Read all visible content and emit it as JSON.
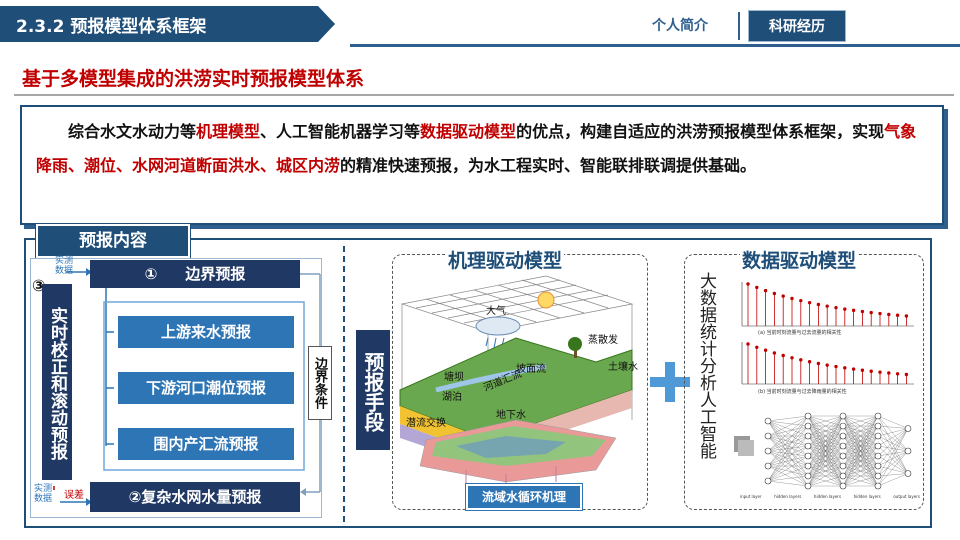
{
  "header": {
    "title": "2.3.2 预报模型体系框架",
    "nav": [
      "个人简介",
      "科研经历"
    ]
  },
  "subtitle": "基于多模型集成的洪涝实时预报模型体系",
  "intro": {
    "p1": "综合水文水动力等",
    "h1": "机理模型",
    "p2": "、人工智能机器学习等",
    "h2": "数据驱动模型",
    "p3": "的优点，构建自适应的洪涝预报模型体系框架，实现",
    "h3": "气象降雨、潮位、水网河道断面洪水、城区内涝",
    "p4": "的精准快速预报，为水工程实时、智能联排联调提供基础。"
  },
  "panel": {
    "tab": "预报内容",
    "top_small": "实测\n数据",
    "marker_1": "①",
    "boundary_forecast": "边界预报",
    "marker_3": "③",
    "realtime": "实时校正和滚动预报",
    "items": [
      "上游来水预报",
      "下游河口潮位预报",
      "围内产汇流预报"
    ],
    "boundary_condition": "边界条件",
    "bottom_small": "实测\n数据",
    "error": "误差",
    "complex": "②复杂水网水量预报"
  },
  "stage_label": "预报手段",
  "mechanism": {
    "title": "机理驱动模型",
    "labels": {
      "atmosphere": "大气",
      "evap": "蒸散发",
      "soil": "土壤水",
      "dam": "塘坝",
      "lake": "湖泊",
      "river": "河道汇流",
      "slope": "坡面流",
      "groundwater": "地下水",
      "exchange": "潜流交换"
    },
    "caption": "流域水循环机理"
  },
  "plus": "+",
  "data_driven": {
    "title": "数据驱动模型",
    "vertical_text": "大数据统计分析人工智能",
    "caption_a": "(a) 当前时刻流量与过去流量的相关性",
    "caption_b": "(b) 当前时刻流量与过去降雨量的相关性",
    "nn_labels": [
      "input layer",
      "hidden layers",
      "hidden layers",
      "hidden layers",
      "output layers"
    ]
  },
  "colors": {
    "primary": "#1f4e79",
    "accent_red": "#c00000",
    "button_blue": "#2e75b6"
  }
}
